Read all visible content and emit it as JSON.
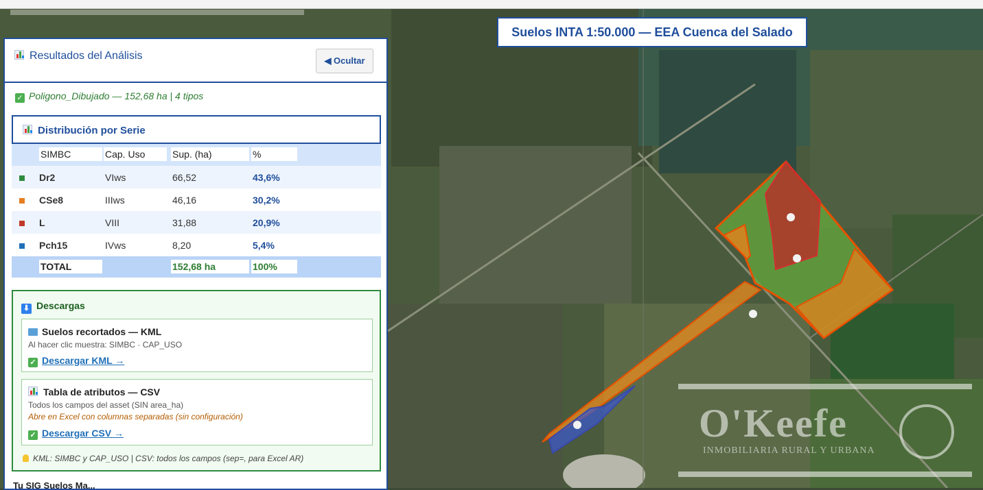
{
  "map": {
    "title": "Suelos INTA 1:50.000 — EEA Cuenca del Salado"
  },
  "panel": {
    "title": "Resultados del Análisis",
    "hide_label": "◀ Ocultar",
    "summary": "Poligono_Dibujado — 152,68 ha | 4 tipos",
    "distribution_title": "Distribución por Serie",
    "table": {
      "headers": [
        "SIMBC",
        "Cap. Uso",
        "Sup. (ha)",
        "%"
      ],
      "rows": [
        {
          "color": "#2e8b3e",
          "code": "Dr2",
          "cap": "VIws",
          "sup": "66,52",
          "pct": "43,6%"
        },
        {
          "color": "#e67e22",
          "code": "CSe8",
          "cap": "IIIws",
          "sup": "46,16",
          "pct": "30,2%"
        },
        {
          "color": "#c0392b",
          "code": "L",
          "cap": "VIII",
          "sup": "31,88",
          "pct": "20,9%"
        },
        {
          "color": "#1f6fb8",
          "code": "Pch15",
          "cap": "IVws",
          "sup": "8,20",
          "pct": "5,4%"
        }
      ],
      "total": {
        "label": "TOTAL",
        "sup": "152,68 ha",
        "pct": "100%"
      }
    },
    "downloads": {
      "title": "Descargas",
      "kml": {
        "title": "Suelos recortados — KML",
        "desc": "Al hacer clic muestra: SIMBC · CAP_USO",
        "link": "Descargar KML →"
      },
      "csv": {
        "title": "Tabla de atributos — CSV",
        "desc": "Todos los campos del asset (SIN area_ha)",
        "note": "Abre en Excel con columnas separadas (sin configuración)",
        "link": "Descargar CSV →"
      },
      "footnote": "KML: SIMBC y CAP_USO | CSV: todos los campos (sep=, para Excel AR)"
    },
    "cut_text": "Tu SIG Suelos Ma..."
  },
  "watermark": {
    "name": "O'Keefe",
    "tagline": "INMOBILIARIA RURAL Y URBANA"
  },
  "colors": {
    "accent": "#1f4e9b",
    "green": "#2e8b3e",
    "orange": "#e67e22",
    "red": "#c0392b",
    "blue": "#1f6fb8"
  }
}
